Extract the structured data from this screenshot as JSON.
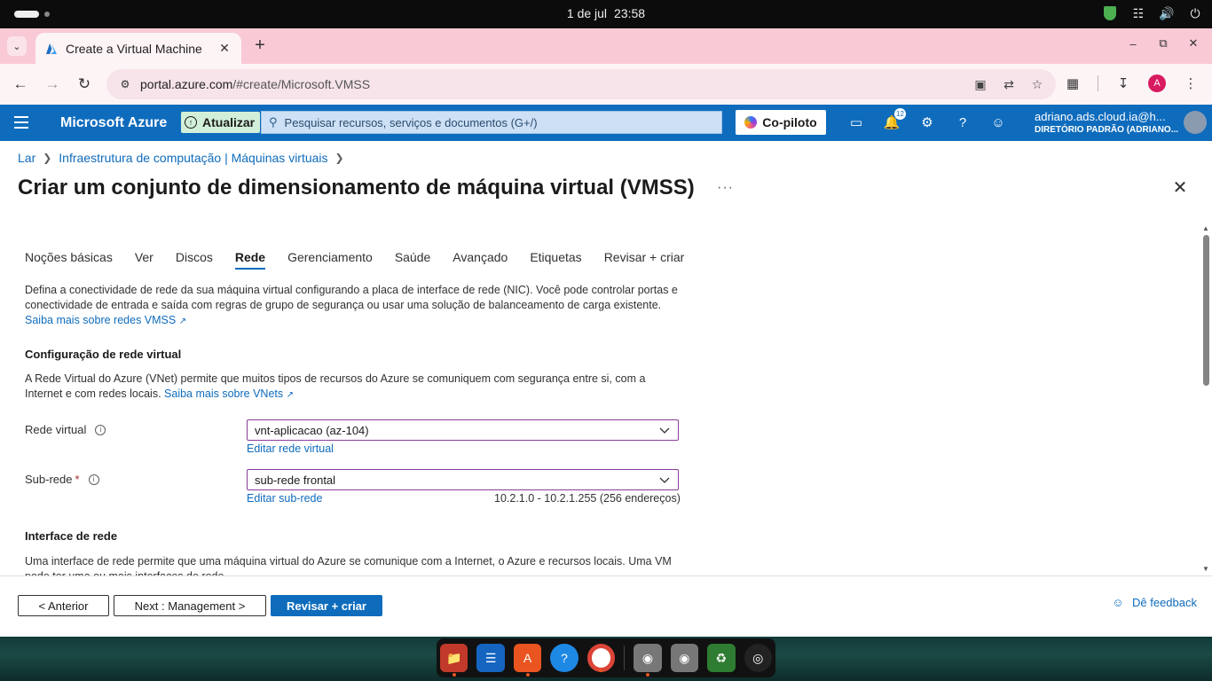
{
  "os": {
    "date": "1 de jul",
    "time": "23:58"
  },
  "browser": {
    "tab_title": "Create a Virtual Machine",
    "url_host": "portal.azure.com",
    "url_path": "/#create/Microsoft.VMSS",
    "profile_initial": "A"
  },
  "azure": {
    "brand": "Microsoft Azure",
    "update_label": "Atualizar",
    "search_placeholder": "Pesquisar recursos, serviços e documentos (G+/)",
    "copilot_label": "Co-piloto",
    "notifications_count": "12",
    "user_email": "adriano.ads.cloud.ia@h...",
    "user_directory": "DIRETÓRIO PADRÃO (ADRIANO..."
  },
  "breadcrumb": [
    "Lar",
    "Infraestrutura de computação | Máquinas virtuais"
  ],
  "page_title": "Criar um conjunto de dimensionamento de máquina virtual (VMSS)",
  "more_label": "···",
  "tabs": [
    {
      "label": "Noções básicas",
      "active": false
    },
    {
      "label": "Ver",
      "active": false
    },
    {
      "label": "Discos",
      "active": false
    },
    {
      "label": "Rede",
      "active": true
    },
    {
      "label": "Gerenciamento",
      "active": false
    },
    {
      "label": "Saúde",
      "active": false
    },
    {
      "label": "Avançado",
      "active": false
    },
    {
      "label": "Etiquetas",
      "active": false
    },
    {
      "label": "Revisar + criar",
      "active": false
    }
  ],
  "intro": {
    "text": "Defina a conectividade de rede da sua máquina virtual configurando a placa de interface de rede (NIC). Você pode controlar portas e conectividade de entrada e saída com regras de grupo de segurança ou usar uma solução de balanceamento de carga existente.",
    "link": "Saiba mais sobre redes VMSS"
  },
  "vnet_section": {
    "heading": "Configuração de rede virtual",
    "text": "A Rede Virtual do Azure (VNet) permite que muitos tipos de recursos do Azure se comuniquem com segurança entre si, com a Internet e com redes locais.",
    "link": "Saiba mais sobre VNets"
  },
  "fields": {
    "vnet_label": "Rede virtual",
    "vnet_value": "vnt-aplicacao (az-104)",
    "vnet_edit": "Editar rede virtual",
    "subnet_label": "Sub-rede",
    "subnet_required": "*",
    "subnet_value": "sub-rede frontal",
    "subnet_edit": "Editar sub-rede",
    "subnet_range": "10.2.1.0 - 10.2.1.255 (256 endereços)"
  },
  "nic_section": {
    "heading": "Interface de rede",
    "text": "Uma interface de rede permite que uma máquina virtual do Azure se comunique com a Internet, o Azure e recursos locais. Uma VM pode ter uma ou mais interfaces de rede."
  },
  "footer": {
    "prev": "< Anterior",
    "next": "Next : Management >",
    "review": "Revisar + criar",
    "feedback": "Dê feedback"
  },
  "colors": {
    "azure_blue": "#0f6cbd",
    "select_border": "#8a3d9a",
    "tab_strip": "#f9cad6"
  }
}
